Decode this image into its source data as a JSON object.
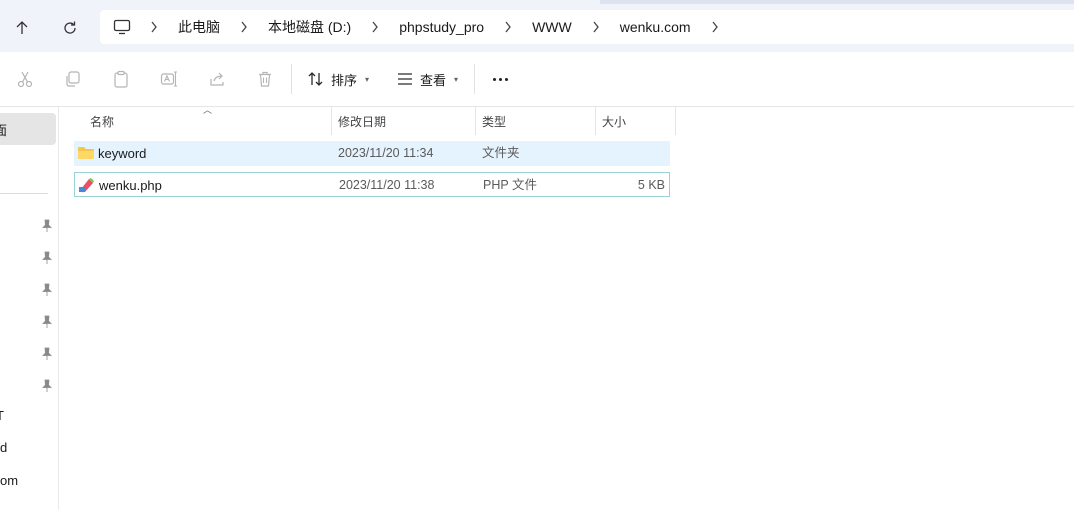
{
  "breadcrumb": {
    "items": [
      "此电脑",
      "本地磁盘 (D:)",
      "phpstudy_pro",
      "WWW",
      "wenku.com"
    ]
  },
  "toolbar": {
    "sort_label": "排序",
    "view_label": "查看"
  },
  "navpane": {
    "selected_fragment": "面",
    "fragments": [
      "T",
      "d",
      "om"
    ]
  },
  "columns": {
    "name": "名称",
    "date": "修改日期",
    "type": "类型",
    "size": "大小"
  },
  "files": [
    {
      "name": "keyword",
      "date": "2023/11/20 11:34",
      "type": "文件夹",
      "size": "",
      "icon": "folder-icon"
    },
    {
      "name": "wenku.php",
      "date": "2023/11/20 11:38",
      "type": "PHP 文件",
      "size": "5 KB",
      "icon": "php-file-icon"
    }
  ],
  "colors": {
    "address_bg": "#f0f3f9",
    "hover_row": "#e5f3ff",
    "selected_border": "#99d1d8",
    "folder": "#f5c64e"
  }
}
